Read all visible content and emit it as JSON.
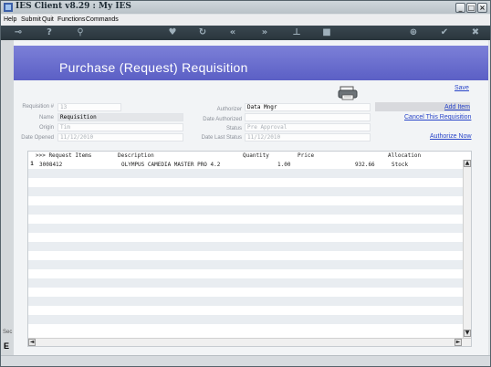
{
  "window": {
    "title": "IES Client v8.29 : My IES",
    "min_glyph": "_",
    "max_glyph": "□",
    "close_glyph": "×"
  },
  "menu": {
    "items": [
      "Help",
      "Submit",
      "Quit",
      "Functions",
      "Commands"
    ]
  },
  "toolbar": {
    "icons": [
      "key-icon",
      "help-icon",
      "search-icon",
      "heart-icon",
      "refresh-icon",
      "rewind-icon",
      "forward-icon",
      "bookmark-icon",
      "stop-icon",
      "add-icon",
      "check-icon",
      "close-icon"
    ],
    "glyphs": [
      "⊸",
      "?",
      "⚲",
      "♥",
      "↻",
      "«",
      "»",
      "⊥",
      "■",
      "⊕",
      "✔",
      "✖"
    ]
  },
  "left_strip": {
    "cut_text_1": "Sec",
    "cut_text_2": "E"
  },
  "page": {
    "heading": "Purchase (Request) Requisition",
    "save_link": "Save",
    "add_item_link": "Add Item",
    "cancel_link": "Cancel This Requisition",
    "authorize_link": "Authorize Now"
  },
  "form": {
    "requisition_no_label": "Requisition #",
    "requisition_no_value": "13",
    "name_label": "Name",
    "name_value": "Requisition",
    "origin_label": "Origin",
    "origin_value": "Tim",
    "date_opened_label": "Date Opened",
    "date_opened_value": "11/12/2010",
    "authorizer_label": "Authorizer",
    "authorizer_value": "Data Mngr",
    "date_authorized_label": "Date Authorized",
    "date_authorized_value": "",
    "status_label": "Status",
    "status_value": "Pre Approval",
    "date_last_status_label": "Date Last Status",
    "date_last_status_value": "11/12/2010"
  },
  "grid": {
    "columns": [
      ">>> Request Items",
      "Description",
      "Quantity",
      "Price",
      "Allocation"
    ],
    "rows": [
      {
        "num": "1",
        "item": "3008412",
        "description": "OLYMPUS CAMEDIA MASTER PRO 4.2",
        "quantity": "1.00",
        "price": "932.66",
        "allocation": "Stock"
      }
    ],
    "scroll_up": "▲",
    "scroll_down": "▼",
    "scroll_left": "◄",
    "scroll_right": "►"
  },
  "colors": {
    "banner": "#5b5fc5",
    "link": "#2844c8",
    "toolbar": "#2a353c"
  }
}
